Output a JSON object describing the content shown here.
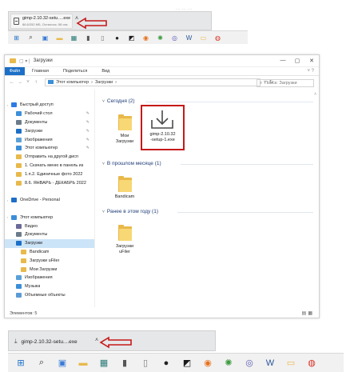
{
  "top_caption": "… … …",
  "download_bar_1": {
    "file_name": "gimp-2.10.32-setu….exe",
    "file_status": "86.6/252 МБ, Осталось: 58 сек."
  },
  "download_bar_2": {
    "file_name": "gimp-2.10.32-setu....exe"
  },
  "taskbar_icons": [
    {
      "name": "windows-start-icon",
      "glyph": "⊞",
      "color": "#1c6fc7"
    },
    {
      "name": "search-icon",
      "glyph": "⌕",
      "color": "#333333"
    },
    {
      "name": "store-icon",
      "glyph": "▣",
      "color": "#3a7bd5"
    },
    {
      "name": "folder-icon",
      "glyph": "▬",
      "color": "#e8b94b"
    },
    {
      "name": "app-icon",
      "glyph": "▦",
      "color": "#2b7a78"
    },
    {
      "name": "usb-icon",
      "glyph": "▮",
      "color": "#555555"
    },
    {
      "name": "document-icon",
      "glyph": "▯",
      "color": "#7a7a7a"
    },
    {
      "name": "record-icon",
      "glyph": "●",
      "color": "#222222"
    },
    {
      "name": "capture-icon",
      "glyph": "◩",
      "color": "#1a1a1a"
    },
    {
      "name": "firefox-icon",
      "glyph": "◉",
      "color": "#e8711c"
    },
    {
      "name": "settings-icon",
      "glyph": "✺",
      "color": "#3c9a3c"
    },
    {
      "name": "viewer-icon",
      "glyph": "◎",
      "color": "#5b5bb5"
    },
    {
      "name": "word-icon",
      "glyph": "W",
      "color": "#2b579a"
    },
    {
      "name": "explorer-icon",
      "glyph": "▭",
      "color": "#e8b94b"
    },
    {
      "name": "chrome-icon",
      "glyph": "◍",
      "color": "#d93025"
    }
  ],
  "explorer": {
    "title": "Загрузки",
    "ribbon_tabs": [
      "Файл",
      "Главная",
      "Поделиться",
      "Вид"
    ],
    "address_parts": [
      "Этот компьютер",
      "›",
      "Загрузки",
      "›"
    ],
    "search_placeholder": "Поиск: Загрузки",
    "nav_items": [
      {
        "label": "Быстрый доступ",
        "icon": "star-icon",
        "color": "#2c7be5",
        "indent": 0,
        "pin": false
      },
      {
        "label": "Рабочий стол",
        "icon": "desktop-icon",
        "color": "#3d8fd9",
        "indent": 1,
        "pin": true
      },
      {
        "label": "Документы",
        "icon": "documents-icon",
        "color": "#6b7b8c",
        "indent": 1,
        "pin": true
      },
      {
        "label": "Загрузки",
        "icon": "downloads-icon",
        "color": "#1c6fc7",
        "indent": 1,
        "pin": true
      },
      {
        "label": "Изображения",
        "icon": "pictures-icon",
        "color": "#5aa0d8",
        "indent": 1,
        "pin": true
      },
      {
        "label": "Этот компьютер",
        "icon": "computer-icon",
        "color": "#3b8ed8",
        "indent": 1,
        "pin": true
      },
      {
        "label": "Отправить на другой дисп",
        "icon": "folder-icon",
        "color": "#e8b94b",
        "indent": 1,
        "pin": false
      },
      {
        "label": "1. Скачать меню в панель из",
        "icon": "folder-icon",
        "color": "#e8b94b",
        "indent": 1,
        "pin": false
      },
      {
        "label": "1.п.2. Единичные фото 2022",
        "icon": "folder-icon",
        "color": "#e8b94b",
        "indent": 1,
        "pin": false
      },
      {
        "label": "8.6. ЯНВАРЬ - ДЕКАБРЬ 2022",
        "icon": "folder-icon",
        "color": "#e8b94b",
        "indent": 1,
        "pin": false
      },
      {
        "label": "",
        "icon": "spacer",
        "color": "transparent",
        "indent": 0,
        "pin": false
      },
      {
        "label": "OneDrive - Personal",
        "icon": "onedrive-icon",
        "color": "#1c6fc7",
        "indent": 0,
        "pin": false
      },
      {
        "label": "",
        "icon": "spacer",
        "color": "transparent",
        "indent": 0,
        "pin": false
      },
      {
        "label": "Этот компьютер",
        "icon": "computer-icon",
        "color": "#3b8ed8",
        "indent": 0,
        "pin": false
      },
      {
        "label": "Видео",
        "icon": "video-icon",
        "color": "#6a6a9a",
        "indent": 1,
        "pin": false
      },
      {
        "label": "Документы",
        "icon": "documents-icon",
        "color": "#6b7b8c",
        "indent": 1,
        "pin": false
      },
      {
        "label": "Загрузки",
        "icon": "downloads-icon",
        "color": "#1c6fc7",
        "indent": 1,
        "pin": false,
        "selected": true
      },
      {
        "label": "Bandicam",
        "icon": "folder-icon",
        "color": "#e8b94b",
        "indent": 2,
        "pin": false
      },
      {
        "label": "Загрузки uFiler",
        "icon": "folder-icon",
        "color": "#e8b94b",
        "indent": 2,
        "pin": false
      },
      {
        "label": "Мои Загрузки",
        "icon": "folder-icon",
        "color": "#e8b94b",
        "indent": 2,
        "pin": false
      },
      {
        "label": "Изображения",
        "icon": "pictures-icon",
        "color": "#5aa0d8",
        "indent": 1,
        "pin": false
      },
      {
        "label": "Музыка",
        "icon": "music-icon",
        "color": "#3b8ed8",
        "indent": 1,
        "pin": false
      },
      {
        "label": "Объемные объекты",
        "icon": "3d-objects-icon",
        "color": "#5b9bd5",
        "indent": 1,
        "pin": false
      }
    ],
    "groups": [
      {
        "heading": "Сегодня (2)"
      },
      {
        "heading": "В прошлом месяце (1)"
      },
      {
        "heading": "Ранее в этом году (1)"
      }
    ],
    "files": {
      "today_folder_label": [
        "Мои",
        "Загрузки"
      ],
      "today_installer_label": [
        "gimp-2.10.32",
        "-setup-1.exe"
      ],
      "last_month_folder_label": [
        "Bandicam"
      ],
      "earlier_folder_label": [
        "Загрузки",
        "uFiler"
      ]
    },
    "status": "Элементов: 5"
  },
  "highlight_color": "#c51919"
}
